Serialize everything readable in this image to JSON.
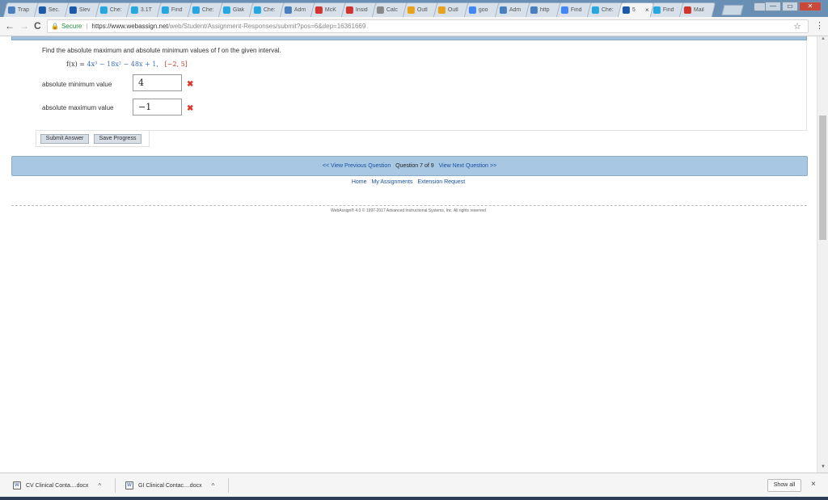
{
  "browser": {
    "tabs": [
      {
        "label": "Trap",
        "icon_color": "#4a7fbf",
        "active": false
      },
      {
        "label": "Sec.",
        "icon_color": "#1c5aa8",
        "active": false
      },
      {
        "label": "Slev",
        "icon_color": "#1c5aa8",
        "active": false
      },
      {
        "label": "Che:",
        "icon_color": "#26a7e0",
        "active": false
      },
      {
        "label": "3.1T",
        "icon_color": "#26a7e0",
        "active": false
      },
      {
        "label": "Find",
        "icon_color": "#26a7e0",
        "active": false
      },
      {
        "label": "Che:",
        "icon_color": "#26a7e0",
        "active": false
      },
      {
        "label": "Glak",
        "icon_color": "#26a7e0",
        "active": false
      },
      {
        "label": "Che:",
        "icon_color": "#26a7e0",
        "active": false
      },
      {
        "label": "Adm",
        "icon_color": "#4a7fbf",
        "active": false
      },
      {
        "label": "McK",
        "icon_color": "#d0342c",
        "active": false
      },
      {
        "label": "Insid",
        "icon_color": "#d0342c",
        "active": false
      },
      {
        "label": "Calc",
        "icon_color": "#888888",
        "active": false
      },
      {
        "label": "Outl",
        "icon_color": "#e8a21b",
        "active": false
      },
      {
        "label": "Outl",
        "icon_color": "#e8a21b",
        "active": false
      },
      {
        "label": "goo",
        "icon_color": "#4285f4",
        "active": false
      },
      {
        "label": "Adm",
        "icon_color": "#4a7fbf",
        "active": false
      },
      {
        "label": "http",
        "icon_color": "#4a7fbf",
        "active": false
      },
      {
        "label": "Find",
        "icon_color": "#4285f4",
        "active": false
      },
      {
        "label": "Che:",
        "icon_color": "#26a7e0",
        "active": false
      },
      {
        "label": "5",
        "icon_color": "#1c5aa8",
        "active": true
      },
      {
        "label": "Find",
        "icon_color": "#26a7e0",
        "active": false
      },
      {
        "label": "Mail",
        "icon_color": "#d0342c",
        "active": false
      }
    ],
    "active_tab_close": "×",
    "nav": {
      "back": "←",
      "forward": "→",
      "reload": "C"
    },
    "address": {
      "secure_label": "Secure",
      "lock_icon": "lock-icon",
      "url_host": "https://www.webassign.net",
      "url_path": "/web/Student/Assignment-Responses/submit?pos=6&dep=16361669"
    },
    "star": "☆",
    "menu": "⋮",
    "window_controls": {
      "minimize": "—",
      "restore": "▭",
      "close": "✕"
    }
  },
  "question": {
    "prompt": "Find the absolute maximum and absolute minimum values of f on the given interval.",
    "function_lhs": "f(x) = ",
    "function_rhs": "4x³ − 18x² − 48x + 1,",
    "interval": "[−2, 5]",
    "rows": [
      {
        "label": "absolute minimum value",
        "value": "4",
        "status": "incorrect"
      },
      {
        "label": "absolute maximum value",
        "value": "−1",
        "status": "incorrect"
      }
    ],
    "wrong_mark": "✖"
  },
  "buttons": {
    "submit": "Submit Answer",
    "save": "Save Progress"
  },
  "nav_bar": {
    "prev": "<< View Previous Question",
    "status": "Question 7 of 9",
    "next": "View Next Question >>"
  },
  "footer": {
    "home": "Home",
    "assignments": "My Assignments",
    "extension": "Extension Request",
    "copyright": "WebAssign® 4.0 © 1997-2017 Advanced Instructional Systems, Inc. All rights reserved"
  },
  "downloads": {
    "items": [
      {
        "name": "CV Clinical Conta....docx"
      },
      {
        "name": "GI Clinical Contac....docx"
      }
    ],
    "show_all": "Show all",
    "close": "×"
  }
}
